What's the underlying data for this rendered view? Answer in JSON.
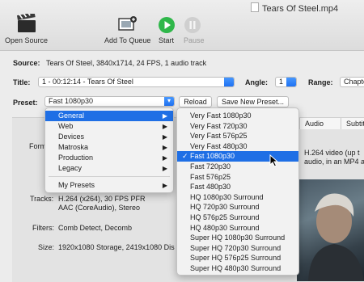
{
  "window": {
    "title": "Tears Of Steel.mp4"
  },
  "toolbar": {
    "open_source": "Open Source",
    "add_to_queue": "Add To Queue",
    "start": "Start",
    "pause": "Pause"
  },
  "source": {
    "label": "Source:",
    "value": "Tears Of Steel, 3840x1714, 24 FPS, 1 audio track"
  },
  "title_row": {
    "label": "Title:",
    "value": "1 - 00:12:14 - Tears Of Steel",
    "angle_label": "Angle:",
    "angle_value": "1",
    "range_label": "Range:",
    "range_value": "Chapte"
  },
  "preset_row": {
    "label": "Preset:",
    "value": "Fast 1080p30",
    "reload": "Reload",
    "save_new": "Save New Preset..."
  },
  "tabs": [
    "Audio",
    "Subtitl"
  ],
  "summary": {
    "format_label": "Form",
    "format_desc_1": "H.264 video (up t",
    "format_desc_2": "audio, in an MP4 a",
    "tracks_label": "Tracks:",
    "tracks_1": "H.264 (x264), 30 FPS PFR",
    "tracks_2": "AAC (CoreAudio), Stereo",
    "filters_label": "Filters:",
    "filters_value": "Comb Detect, Decomb",
    "size_label": "Size:",
    "size_value": "1920x1080 Storage, 2419x1080 Dis"
  },
  "category_menu": {
    "items": [
      "General",
      "Web",
      "Devices",
      "Matroska",
      "Production",
      "Legacy"
    ],
    "my_presets": "My Presets",
    "selected": "General"
  },
  "preset_menu": {
    "items": [
      "Very Fast 1080p30",
      "Very Fast 720p30",
      "Very Fast 576p25",
      "Very Fast 480p30",
      "Fast 1080p30",
      "Fast 720p30",
      "Fast 576p25",
      "Fast 480p30",
      "HQ 1080p30 Surround",
      "HQ 720p30 Surround",
      "HQ 576p25 Surround",
      "HQ 480p30 Surround",
      "Super HQ 1080p30 Surround",
      "Super HQ 720p30 Surround",
      "Super HQ 576p25 Surround",
      "Super HQ 480p30 Surround"
    ],
    "checked": "Fast 1080p30",
    "check_glyph": "✓"
  },
  "colors": {
    "accent": "#1f6fe5",
    "start_green": "#2fb74a"
  }
}
